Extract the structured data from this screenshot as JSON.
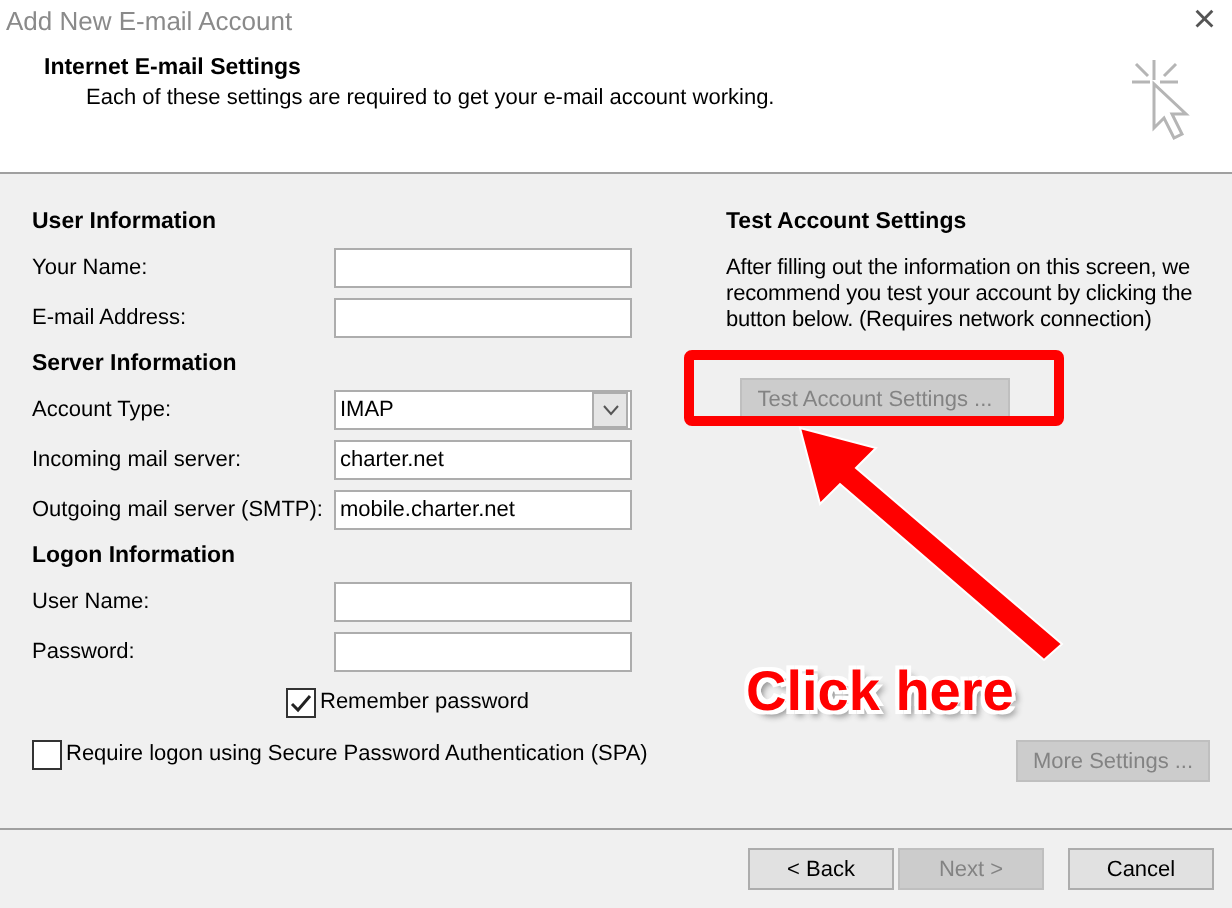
{
  "window": {
    "title": "Add New E-mail Account",
    "close": "×"
  },
  "header": {
    "title": "Internet E-mail Settings",
    "subtitle": "Each of these settings are required to get your e-mail account working."
  },
  "sections": [
    {
      "heading": "User Information",
      "fields": [
        {
          "label": "Your Name:",
          "kind": "text"
        },
        {
          "label": "E-mail Address:",
          "kind": "text"
        }
      ]
    },
    {
      "heading": "Server Information",
      "fields": [
        {
          "label": "Account Type:",
          "kind": "select",
          "value": "IMAP"
        },
        {
          "label": "Incoming mail server:",
          "kind": "text",
          "value": "charter.net"
        },
        {
          "label": "Outgoing mail server (SMTP):",
          "kind": "text",
          "value": "mobile.charter.net"
        }
      ]
    },
    {
      "heading": "Logon Information",
      "fields": [
        {
          "label": "User Name:",
          "kind": "text"
        },
        {
          "label": "Password:",
          "kind": "text"
        }
      ]
    }
  ],
  "remember_password": {
    "label": "Remember password",
    "checked": true
  },
  "spa": {
    "label": "Require logon using Secure Password Authentication (SPA)",
    "checked": false
  },
  "test": {
    "heading": "Test Account Settings",
    "text": "After filling out the information on this screen, we recommend you test your account by clicking the button below. (Requires network connection)",
    "button": {
      "label": "Test Account Settings ...",
      "disabled": true
    }
  },
  "more_settings": {
    "label": "More Settings ...",
    "disabled": true
  },
  "annotation": {
    "label": "Click here"
  },
  "buttons": [
    {
      "label": "< Back",
      "disabled": false
    },
    {
      "label": "Next >",
      "disabled": true
    },
    {
      "label": "Cancel",
      "disabled": false
    }
  ]
}
